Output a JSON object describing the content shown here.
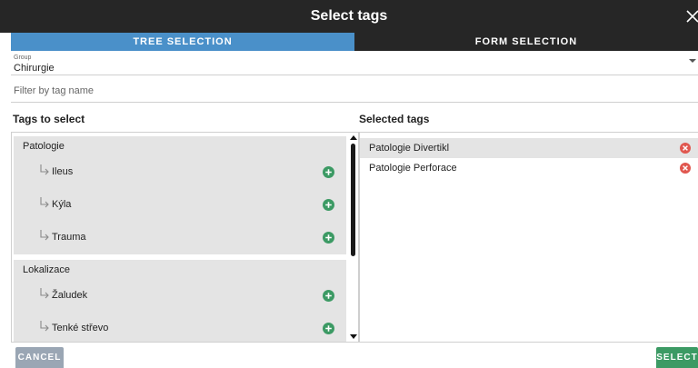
{
  "window": {
    "title": "Select tags"
  },
  "tabs": [
    {
      "label": "TREE SELECTION",
      "active": true
    },
    {
      "label": "FORM SELECTION",
      "active": false
    }
  ],
  "group": {
    "label": "Group",
    "value": "Chirurgie"
  },
  "filter": {
    "placeholder": "Filter by tag name",
    "value": ""
  },
  "left": {
    "heading": "Tags to select",
    "groups": [
      {
        "label": "Patologie",
        "items": [
          "Ileus",
          "Kýla",
          "Trauma"
        ]
      },
      {
        "label": "Lokalizace",
        "items": [
          "Žaludek",
          "Tenké střevo"
        ]
      }
    ]
  },
  "right": {
    "heading": "Selected tags",
    "items": [
      "Patologie Divertikl",
      "Patologie Perforace"
    ]
  },
  "footer": {
    "cancel_label": "CANCEL",
    "select_label": "SELECT"
  },
  "colors": {
    "title_bar": "#262626",
    "active_tab": "#4a90c9",
    "add_icon": "#3c9a64",
    "remove_icon": "#e0574f",
    "cancel_button": "#9aa6b4",
    "select_button": "#3c9a64"
  },
  "icons": {
    "close": "close-icon",
    "expand": "chevron-down-icon",
    "child_arrow": "subdirectory-arrow-icon",
    "add": "plus-circle-icon",
    "remove": "x-circle-icon"
  }
}
